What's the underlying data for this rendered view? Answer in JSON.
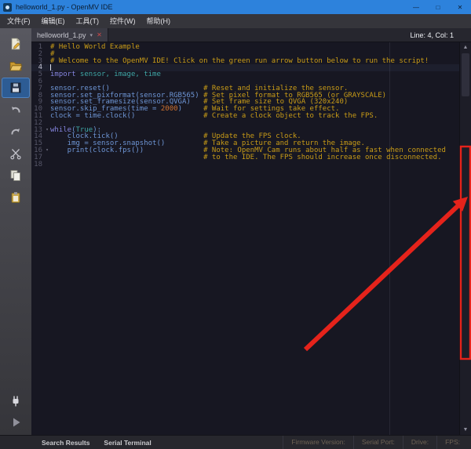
{
  "window": {
    "title": "helloworld_1.py - OpenMV IDE",
    "minimize_glyph": "—",
    "maximize_glyph": "□",
    "close_glyph": "✕"
  },
  "menubar": {
    "items": [
      {
        "label": "文件(F)"
      },
      {
        "label": "编辑(E)"
      },
      {
        "label": "工具(T)"
      },
      {
        "label": "控件(W)"
      },
      {
        "label": "帮助(H)"
      }
    ]
  },
  "sidebar": {
    "top_icons": [
      "new-file-icon",
      "open-file-icon",
      "save-file-icon",
      "undo-icon",
      "redo-icon",
      "cut-icon",
      "copy-icon",
      "paste-icon"
    ],
    "active_icon": "save-file-icon",
    "bottom_icons": [
      "connect-icon",
      "run-icon"
    ]
  },
  "tabbar": {
    "tab_label": "helloworld_1.py",
    "dropdown_glyph": "▾",
    "close_glyph": "✕",
    "cursor_status": "Line: 4, Col: 1"
  },
  "editor": {
    "lines": [
      {
        "n": 1,
        "segs": [
          {
            "t": "# Hello World Example",
            "c": "cm"
          }
        ]
      },
      {
        "n": 2,
        "segs": [
          {
            "t": "#",
            "c": "cm"
          }
        ]
      },
      {
        "n": 3,
        "segs": [
          {
            "t": "# Welcome to the OpenMV IDE! Click on the green run arrow button below to run the script!",
            "c": "cm"
          }
        ]
      },
      {
        "n": 4,
        "caret": true,
        "segs": []
      },
      {
        "n": 5,
        "segs": [
          {
            "t": "import",
            "c": "kw"
          },
          {
            "t": " sensor, image, time",
            "c": "md"
          }
        ]
      },
      {
        "n": 6,
        "segs": []
      },
      {
        "n": 7,
        "segs": [
          {
            "t": "sensor.reset()                      ",
            "c": "id"
          },
          {
            "t": "# Reset and initialize the sensor.",
            "c": "cm"
          }
        ]
      },
      {
        "n": 8,
        "segs": [
          {
            "t": "sensor.set_pixformat(sensor.RGB565) ",
            "c": "id"
          },
          {
            "t": "# Set pixel format to RGB565 (or GRAYSCALE)",
            "c": "cm"
          }
        ]
      },
      {
        "n": 9,
        "segs": [
          {
            "t": "sensor.set_framesize(sensor.QVGA)   ",
            "c": "id"
          },
          {
            "t": "# Set frame size to QVGA (320x240)",
            "c": "cm"
          }
        ]
      },
      {
        "n": 10,
        "segs": [
          {
            "t": "sensor.skip_frames(time = ",
            "c": "id"
          },
          {
            "t": "2000",
            "c": "nm"
          },
          {
            "t": ")     ",
            "c": "id"
          },
          {
            "t": "# Wait for settings take effect.",
            "c": "cm"
          }
        ]
      },
      {
        "n": 11,
        "segs": [
          {
            "t": "clock = time.clock()                ",
            "c": "id"
          },
          {
            "t": "# Create a clock object to track the FPS.",
            "c": "cm"
          }
        ]
      },
      {
        "n": 12,
        "segs": []
      },
      {
        "n": 13,
        "fold": true,
        "segs": [
          {
            "t": "while",
            "c": "kw"
          },
          {
            "t": "(",
            "c": "id"
          },
          {
            "t": "True",
            "c": "ct"
          },
          {
            "t": "):",
            "c": "id"
          }
        ]
      },
      {
        "n": 14,
        "segs": [
          {
            "t": "    clock.tick()                    ",
            "c": "id"
          },
          {
            "t": "# Update the FPS clock.",
            "c": "cm"
          }
        ]
      },
      {
        "n": 15,
        "segs": [
          {
            "t": "    img = sensor.snapshot()         ",
            "c": "id"
          },
          {
            "t": "# Take a picture and return the image.",
            "c": "cm"
          }
        ]
      },
      {
        "n": 16,
        "fold": true,
        "segs": [
          {
            "t": "    print(clock.fps())              ",
            "c": "id"
          },
          {
            "t": "# Note: OpenMV Cam runs about half as fast when connected",
            "c": "cm"
          }
        ]
      },
      {
        "n": 17,
        "segs": [
          {
            "t": "                                    ",
            "c": "id"
          },
          {
            "t": "# to the IDE. The FPS should increase once disconnected.",
            "c": "cm"
          }
        ]
      },
      {
        "n": 18,
        "segs": []
      }
    ],
    "fold_glyph": "▾"
  },
  "scrollbar": {
    "up_glyph": "▲",
    "down_glyph": "▼"
  },
  "statusbar": {
    "left": [
      {
        "label": "Search Results"
      },
      {
        "label": "Serial Terminal"
      }
    ],
    "right": [
      {
        "label": "Firmware Version:"
      },
      {
        "label": "Serial Port:"
      },
      {
        "label": "Drive:"
      },
      {
        "label": "FPS:"
      }
    ]
  },
  "colors": {
    "titlebar_blue": "#2d82dc",
    "annotation_red": "#e5231b",
    "selection_blue": "#2d5c94",
    "comment_yellow": "#c99c17",
    "code_blue": "#6e96d6"
  }
}
